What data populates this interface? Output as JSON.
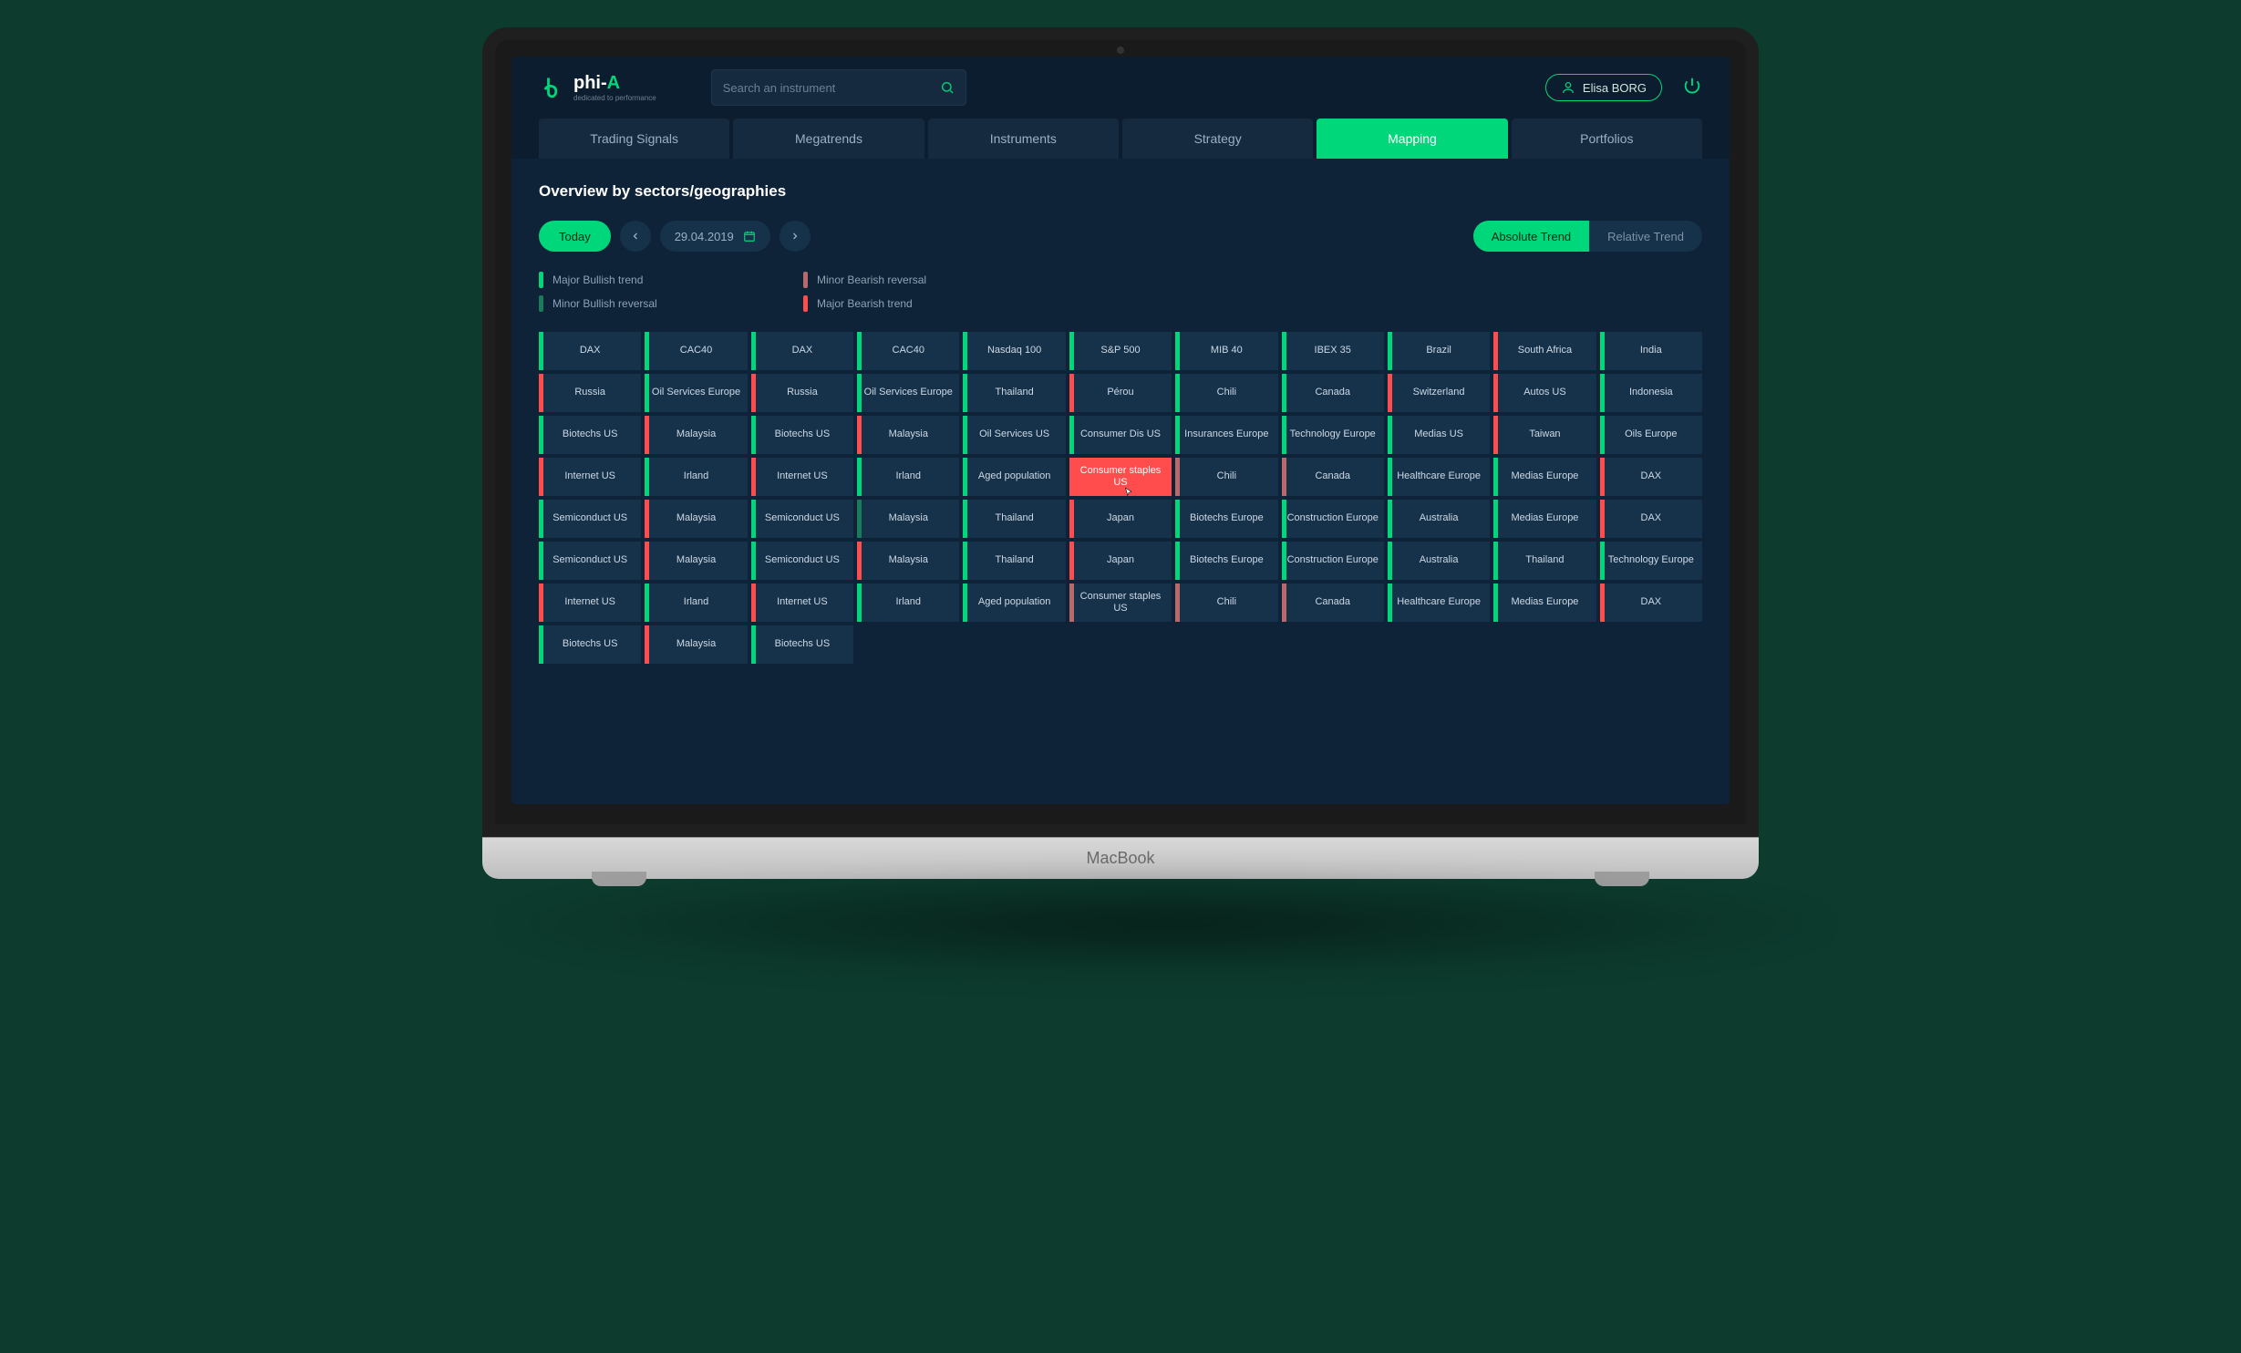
{
  "brand": {
    "name_html": "phi-",
    "suffix": "A",
    "tagline": "dedicated to performance"
  },
  "search": {
    "placeholder": "Search an instrument"
  },
  "user": {
    "name": "Elisa BORG"
  },
  "nav": {
    "items": [
      "Trading Signals",
      "Megatrends",
      "Instruments",
      "Strategy",
      "Mapping",
      "Portfolios"
    ],
    "active_index": 4
  },
  "page_title": "Overview by sectors/geographies",
  "date_controls": {
    "today_label": "Today",
    "date": "29.04.2019"
  },
  "trend_toggle": {
    "options": [
      "Absolute Trend",
      "Relative Trend"
    ],
    "active_index": 0
  },
  "legend": [
    {
      "label": "Major Bullish trend",
      "class": "c-major-bull"
    },
    {
      "label": "Minor Bearish reversal",
      "class": "c-minor-bear"
    },
    {
      "label": "Minor Bullish reversal",
      "class": "c-minor-bull"
    },
    {
      "label": "Major Bearish trend",
      "class": "c-major-bear"
    }
  ],
  "grid": {
    "rows": [
      [
        {
          "t": "DAX",
          "s": "s-green"
        },
        {
          "t": "CAC40",
          "s": "s-green"
        },
        {
          "t": "DAX",
          "s": "s-green"
        },
        {
          "t": "CAC40",
          "s": "s-green"
        },
        {
          "t": "Nasdaq 100",
          "s": "s-green"
        },
        {
          "t": "S&P 500",
          "s": "s-green"
        },
        {
          "t": "MIB 40",
          "s": "s-green"
        },
        {
          "t": "IBEX 35",
          "s": "s-green"
        },
        {
          "t": "Brazil",
          "s": "s-green"
        },
        {
          "t": "South Africa",
          "s": "s-red"
        },
        {
          "t": "India",
          "s": "s-green"
        }
      ],
      [
        {
          "t": "Russia",
          "s": "s-red"
        },
        {
          "t": "Oil Services Europe",
          "s": "s-green"
        },
        {
          "t": "Russia",
          "s": "s-red"
        },
        {
          "t": "Oil Services Europe",
          "s": "s-green"
        },
        {
          "t": "Thailand",
          "s": "s-green"
        },
        {
          "t": "Pérou",
          "s": "s-red"
        },
        {
          "t": "Chili",
          "s": "s-green"
        },
        {
          "t": "Canada",
          "s": "s-green"
        },
        {
          "t": "Switzerland",
          "s": "s-red"
        },
        {
          "t": "Autos US",
          "s": "s-red"
        },
        {
          "t": "Indonesia",
          "s": "s-green"
        }
      ],
      [
        {
          "t": "Biotechs US",
          "s": "s-green"
        },
        {
          "t": "Malaysia",
          "s": "s-red"
        },
        {
          "t": "Biotechs US",
          "s": "s-green"
        },
        {
          "t": "Malaysia",
          "s": "s-red"
        },
        {
          "t": "Oil Services US",
          "s": "s-green"
        },
        {
          "t": "Consumer Dis US",
          "s": "s-green"
        },
        {
          "t": "Insurances Europe",
          "s": "s-green"
        },
        {
          "t": "Technology Europe",
          "s": "s-green"
        },
        {
          "t": "Medias US",
          "s": "s-green"
        },
        {
          "t": "Taiwan",
          "s": "s-red"
        },
        {
          "t": "Oils Europe",
          "s": "s-green"
        }
      ],
      [
        {
          "t": "Internet US",
          "s": "s-red"
        },
        {
          "t": "Irland",
          "s": "s-green"
        },
        {
          "t": "Internet US",
          "s": "s-red"
        },
        {
          "t": "Irland",
          "s": "s-green"
        },
        {
          "t": "Aged population",
          "s": "s-green"
        },
        {
          "t": "Consumer staples US",
          "s": "s-red",
          "hl": true
        },
        {
          "t": "Chili",
          "s": "s-dred"
        },
        {
          "t": "Canada",
          "s": "s-dred"
        },
        {
          "t": "Healthcare Europe",
          "s": "s-green"
        },
        {
          "t": "Medias Europe",
          "s": "s-green"
        },
        {
          "t": "DAX",
          "s": "s-red"
        }
      ],
      [
        {
          "t": "Semiconduct US",
          "s": "s-green"
        },
        {
          "t": "Malaysia",
          "s": "s-red"
        },
        {
          "t": "Semiconduct US",
          "s": "s-green"
        },
        {
          "t": "Malaysia",
          "s": "s-dgreen"
        },
        {
          "t": "Thailand",
          "s": "s-green"
        },
        {
          "t": "Japan",
          "s": "s-red"
        },
        {
          "t": "Biotechs Europe",
          "s": "s-green"
        },
        {
          "t": "Construction Europe",
          "s": "s-green"
        },
        {
          "t": "Australia",
          "s": "s-green"
        },
        {
          "t": "Medias Europe",
          "s": "s-green"
        },
        {
          "t": "DAX",
          "s": "s-red"
        }
      ],
      [
        {
          "t": "Semiconduct US",
          "s": "s-green"
        },
        {
          "t": "Malaysia",
          "s": "s-red"
        },
        {
          "t": "Semiconduct US",
          "s": "s-green"
        },
        {
          "t": "Malaysia",
          "s": "s-red"
        },
        {
          "t": "Thailand",
          "s": "s-green"
        },
        {
          "t": "Japan",
          "s": "s-red"
        },
        {
          "t": "Biotechs Europe",
          "s": "s-green"
        },
        {
          "t": "Construction Europe",
          "s": "s-green"
        },
        {
          "t": "Australia",
          "s": "s-green"
        },
        {
          "t": "Thailand",
          "s": "s-green"
        },
        {
          "t": "Technology Europe",
          "s": "s-green"
        }
      ],
      [
        {
          "t": "Internet US",
          "s": "s-red"
        },
        {
          "t": "Irland",
          "s": "s-green"
        },
        {
          "t": "Internet US",
          "s": "s-red"
        },
        {
          "t": "Irland",
          "s": "s-green"
        },
        {
          "t": "Aged population",
          "s": "s-green"
        },
        {
          "t": "Consumer staples US",
          "s": "s-dred"
        },
        {
          "t": "Chili",
          "s": "s-dred"
        },
        {
          "t": "Canada",
          "s": "s-dred"
        },
        {
          "t": "Healthcare Europe",
          "s": "s-green"
        },
        {
          "t": "Medias Europe",
          "s": "s-green"
        },
        {
          "t": "DAX",
          "s": "s-red"
        }
      ],
      [
        {
          "t": "Biotechs US",
          "s": "s-green"
        },
        {
          "t": "Malaysia",
          "s": "s-red"
        },
        {
          "t": "Biotechs US",
          "s": "s-green"
        }
      ]
    ]
  },
  "device_label": "MacBook"
}
